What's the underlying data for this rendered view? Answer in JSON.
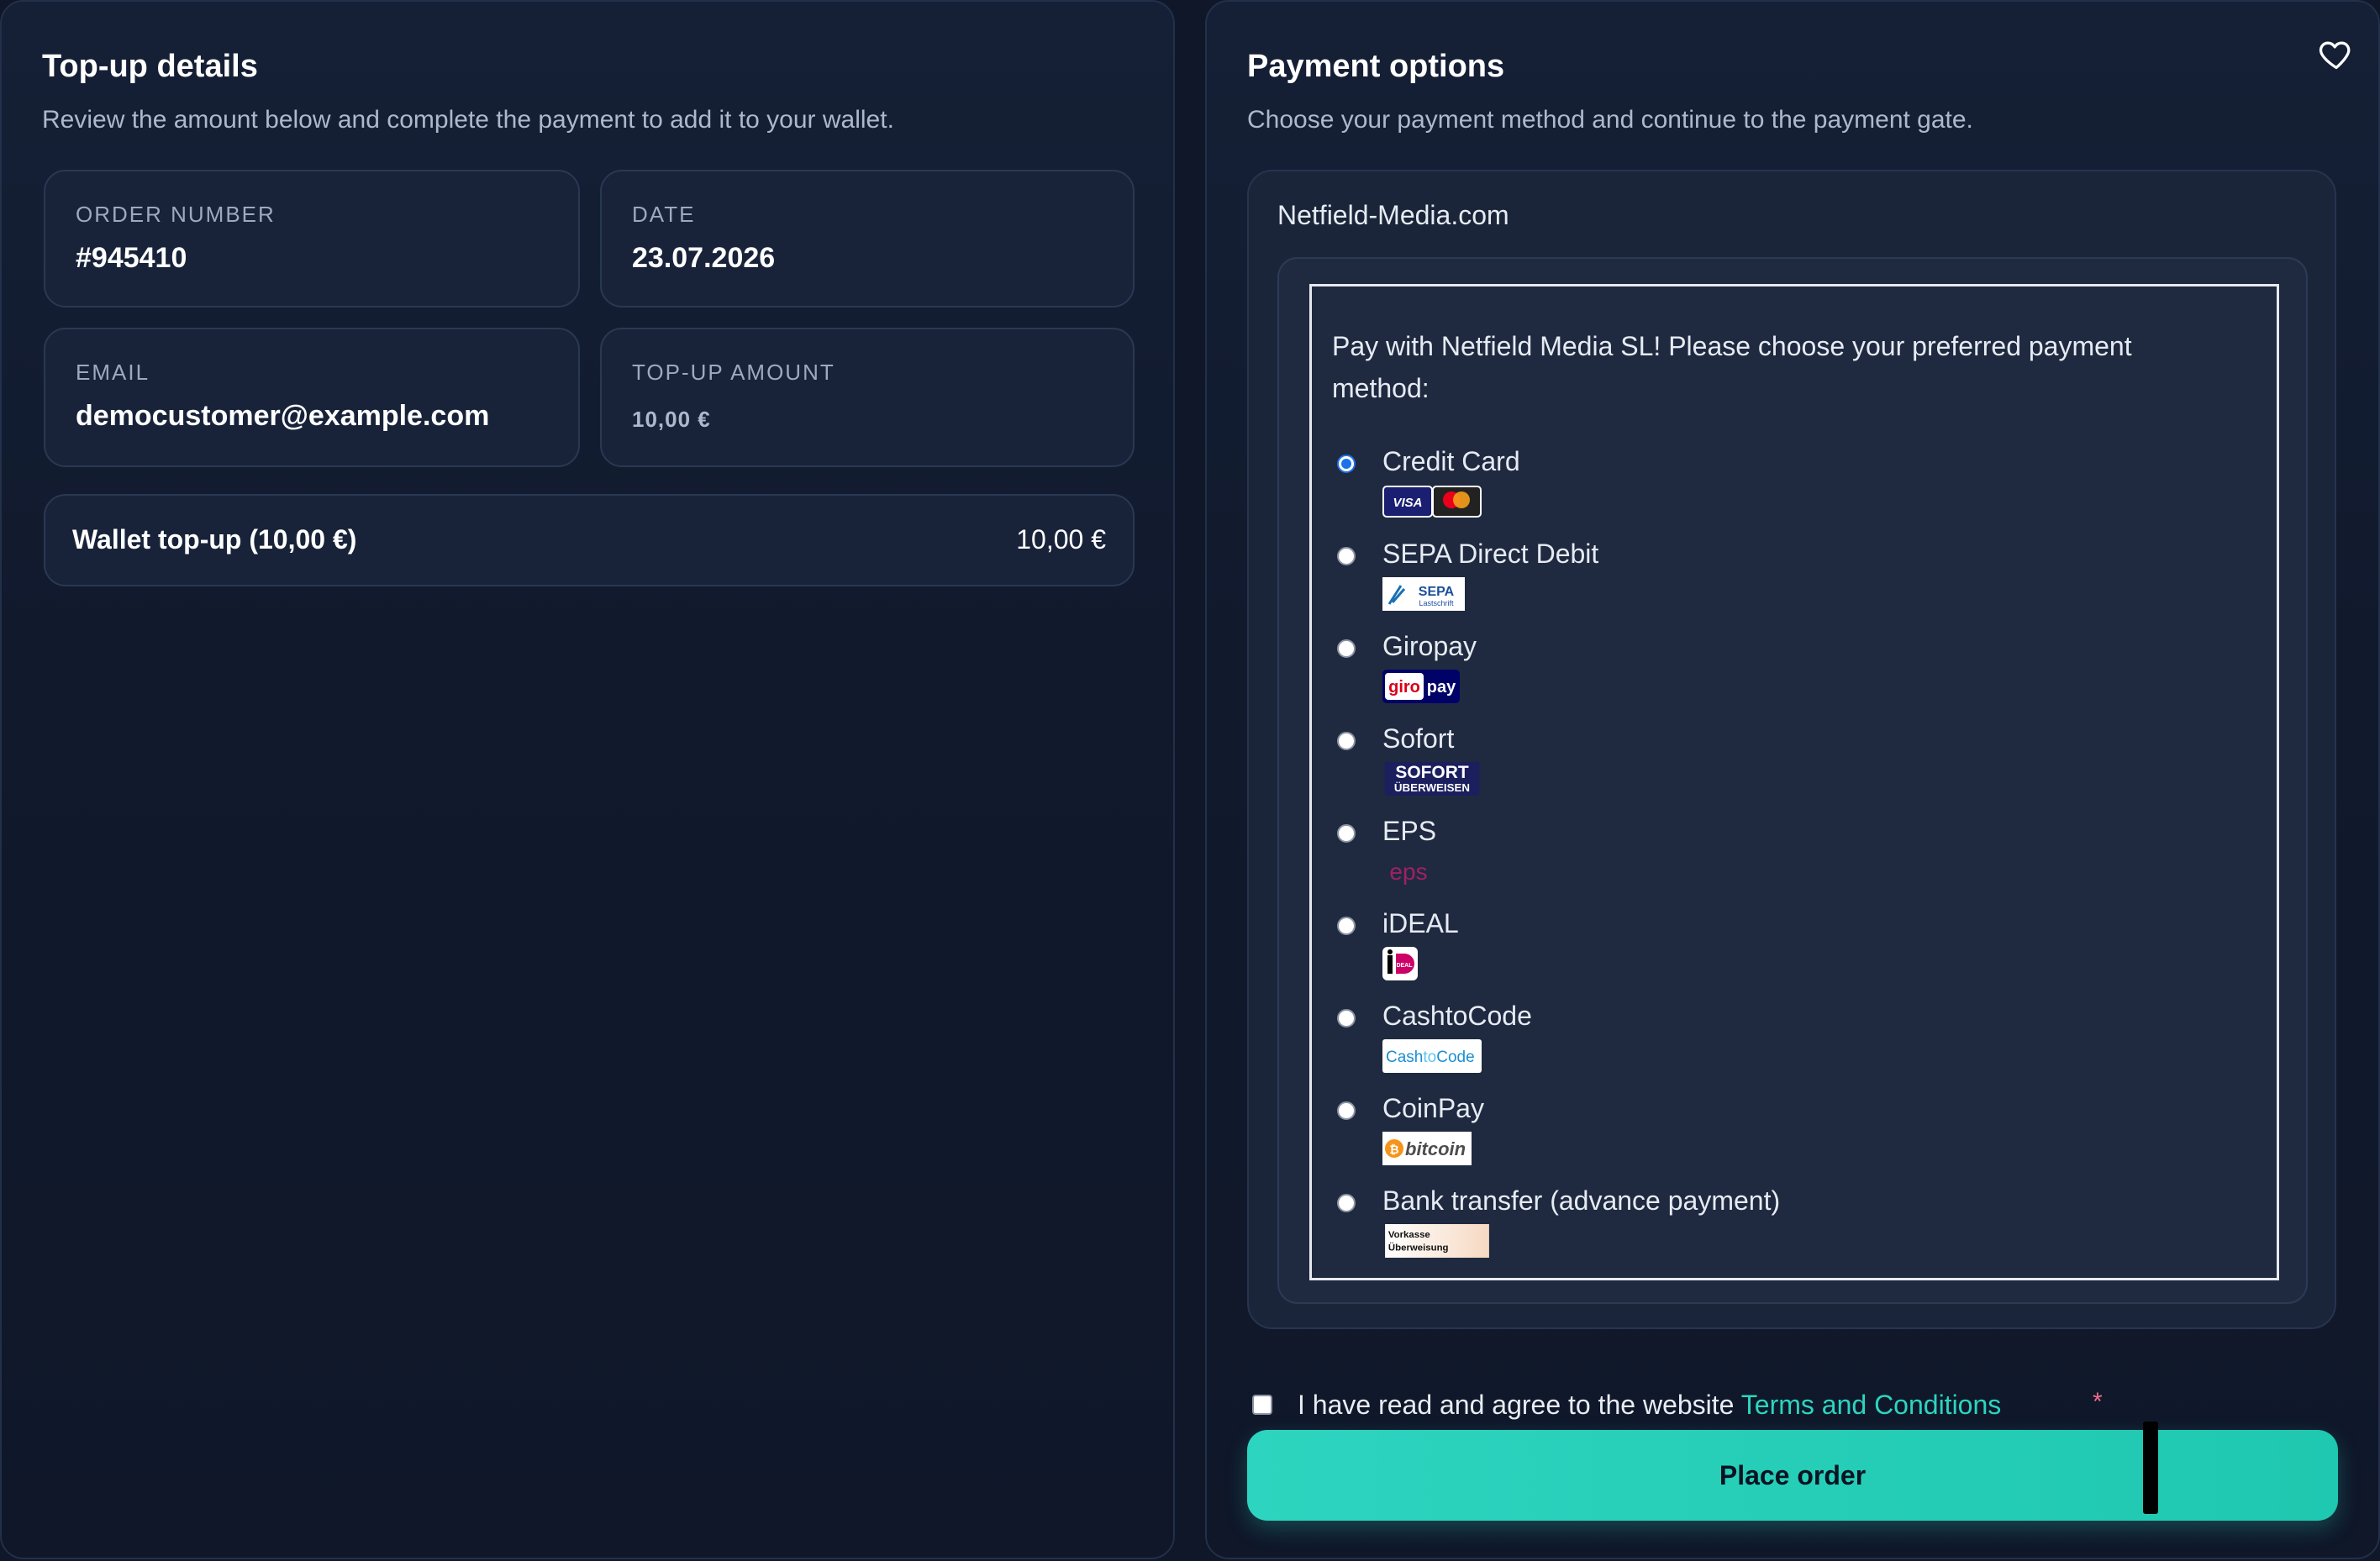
{
  "left": {
    "title": "Top-up details",
    "subtitle": "Review the amount below and complete the payment to add it to your wallet.",
    "order_number": {
      "label": "ORDER NUMBER",
      "value": "#945410"
    },
    "date": {
      "label": "DATE",
      "value": "23.07.2026"
    },
    "email": {
      "label": "EMAIL",
      "value": "democustomer@example.com"
    },
    "topup_amount": {
      "label": "TOP-UP AMOUNT",
      "value": "10,00 €"
    },
    "line_item": {
      "label": "Wallet top-up (10,00 €)",
      "amount": "10,00 €"
    }
  },
  "right": {
    "title": "Payment options",
    "subtitle": "Choose your payment method and continue to the payment gate.",
    "gateway_name": "Netfield-Media.com",
    "intro": "Pay with Netfield Media SL! Please choose your preferred payment method:",
    "methods": [
      {
        "label": "Credit Card",
        "selected": true,
        "logo": "visa-mastercard-logo"
      },
      {
        "label": "SEPA Direct Debit",
        "selected": false,
        "logo": "sepa-lastschrift-logo"
      },
      {
        "label": "Giropay",
        "selected": false,
        "logo": "giropay-logo"
      },
      {
        "label": "Sofort",
        "selected": false,
        "logo": "sofort-ueberweisen-logo"
      },
      {
        "label": "EPS",
        "selected": false,
        "logo": "eps-logo"
      },
      {
        "label": "iDEAL",
        "selected": false,
        "logo": "ideal-logo"
      },
      {
        "label": "CashtoCode",
        "selected": false,
        "logo": "cashtocode-logo"
      },
      {
        "label": "CoinPay",
        "selected": false,
        "logo": "bitcoin-logo"
      },
      {
        "label": "Bank transfer (advance payment)",
        "selected": false,
        "logo": "vorkasse-ueberweisung-logo"
      }
    ],
    "logo_text": {
      "visa": "VISA",
      "sepa": "SEPA",
      "sepa_sub": "Lastschrift",
      "giro": "giro",
      "pay": "pay",
      "sofort": "SOFORT",
      "sofort_sub": "ÜBERWEISEN",
      "eps": "eps",
      "ideal": "iDEAL",
      "cash": "Cash",
      "to": "to",
      "code": "Code",
      "bitcoin": "bitcoin",
      "vorkasse": "Vorkasse",
      "ueberweisung": "Überweisung"
    },
    "agree_text": "I have read and agree to the website ",
    "terms_link": "Terms and Conditions",
    "required_mark": "*",
    "order_button": "Place order"
  },
  "colors": {
    "accent": "#2dd4bf",
    "background": "#0f1729",
    "card": "#18233a",
    "required": "#f16d8b"
  }
}
